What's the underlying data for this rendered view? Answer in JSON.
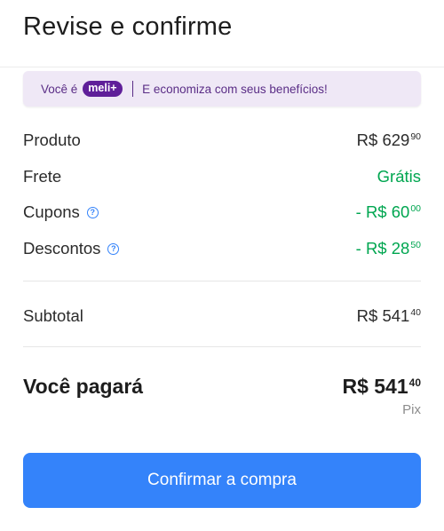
{
  "header": {
    "title": "Revise e confirme"
  },
  "banner": {
    "prefix": "Você é",
    "badge": "meli+",
    "message": "E economiza com seus benefícios!"
  },
  "summary": {
    "rows": [
      {
        "label": "Produto",
        "amount": "R$ 629",
        "cents": "90",
        "has_help": false,
        "color": "default"
      },
      {
        "label": "Frete",
        "amount": "Grátis",
        "cents": "",
        "has_help": false,
        "color": "#00a650"
      },
      {
        "label": "Cupons",
        "amount": "- R$ 60",
        "cents": "00",
        "has_help": true,
        "color": "#00a650"
      },
      {
        "label": "Descontos",
        "amount": "- R$ 28",
        "cents": "50",
        "has_help": true,
        "color": "#00a650"
      }
    ],
    "subtotal": {
      "label": "Subtotal",
      "amount": "R$ 541",
      "cents": "40"
    }
  },
  "total": {
    "label": "Você pagará",
    "amount": "R$ 541",
    "cents": "40",
    "payment_method": "Pix"
  },
  "confirm_button": {
    "label": "Confirmar a compra"
  },
  "colors": {
    "accent_blue": "#3483fa",
    "discount_green": "#00a650",
    "meli_purple": "#5f1f99",
    "banner_bg": "#efe8f6"
  },
  "icons": {
    "help": "question-circle-icon"
  }
}
